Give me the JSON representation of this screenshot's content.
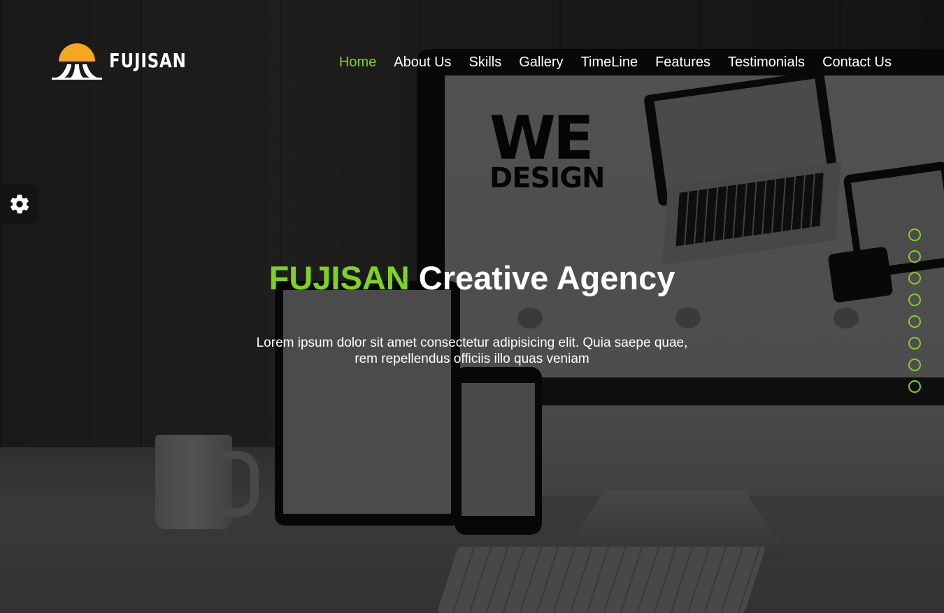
{
  "brand": {
    "logo_text": "FUJISAN",
    "accent_color": "#7ed321",
    "logo_icon": "mount-fuji-sun-icon"
  },
  "nav": {
    "items": [
      {
        "label": "Home",
        "active": true
      },
      {
        "label": "About Us",
        "active": false
      },
      {
        "label": "Skills",
        "active": false
      },
      {
        "label": "Gallery",
        "active": false
      },
      {
        "label": "TimeLine",
        "active": false
      },
      {
        "label": "Features",
        "active": false
      },
      {
        "label": "Testimonials",
        "active": false
      },
      {
        "label": "Contact Us",
        "active": false
      }
    ]
  },
  "settings": {
    "icon": "gear-icon"
  },
  "hero": {
    "title_brand": "FUJISAN",
    "title_rest": "Creative Agency",
    "subtitle_line1": "Lorem ipsum dolor sit amet consectetur adipisicing elit. Quia saepe quae,",
    "subtitle_line2": "rem repellendus officiis illo quas veniam"
  },
  "slider": {
    "dot_count": 8
  }
}
